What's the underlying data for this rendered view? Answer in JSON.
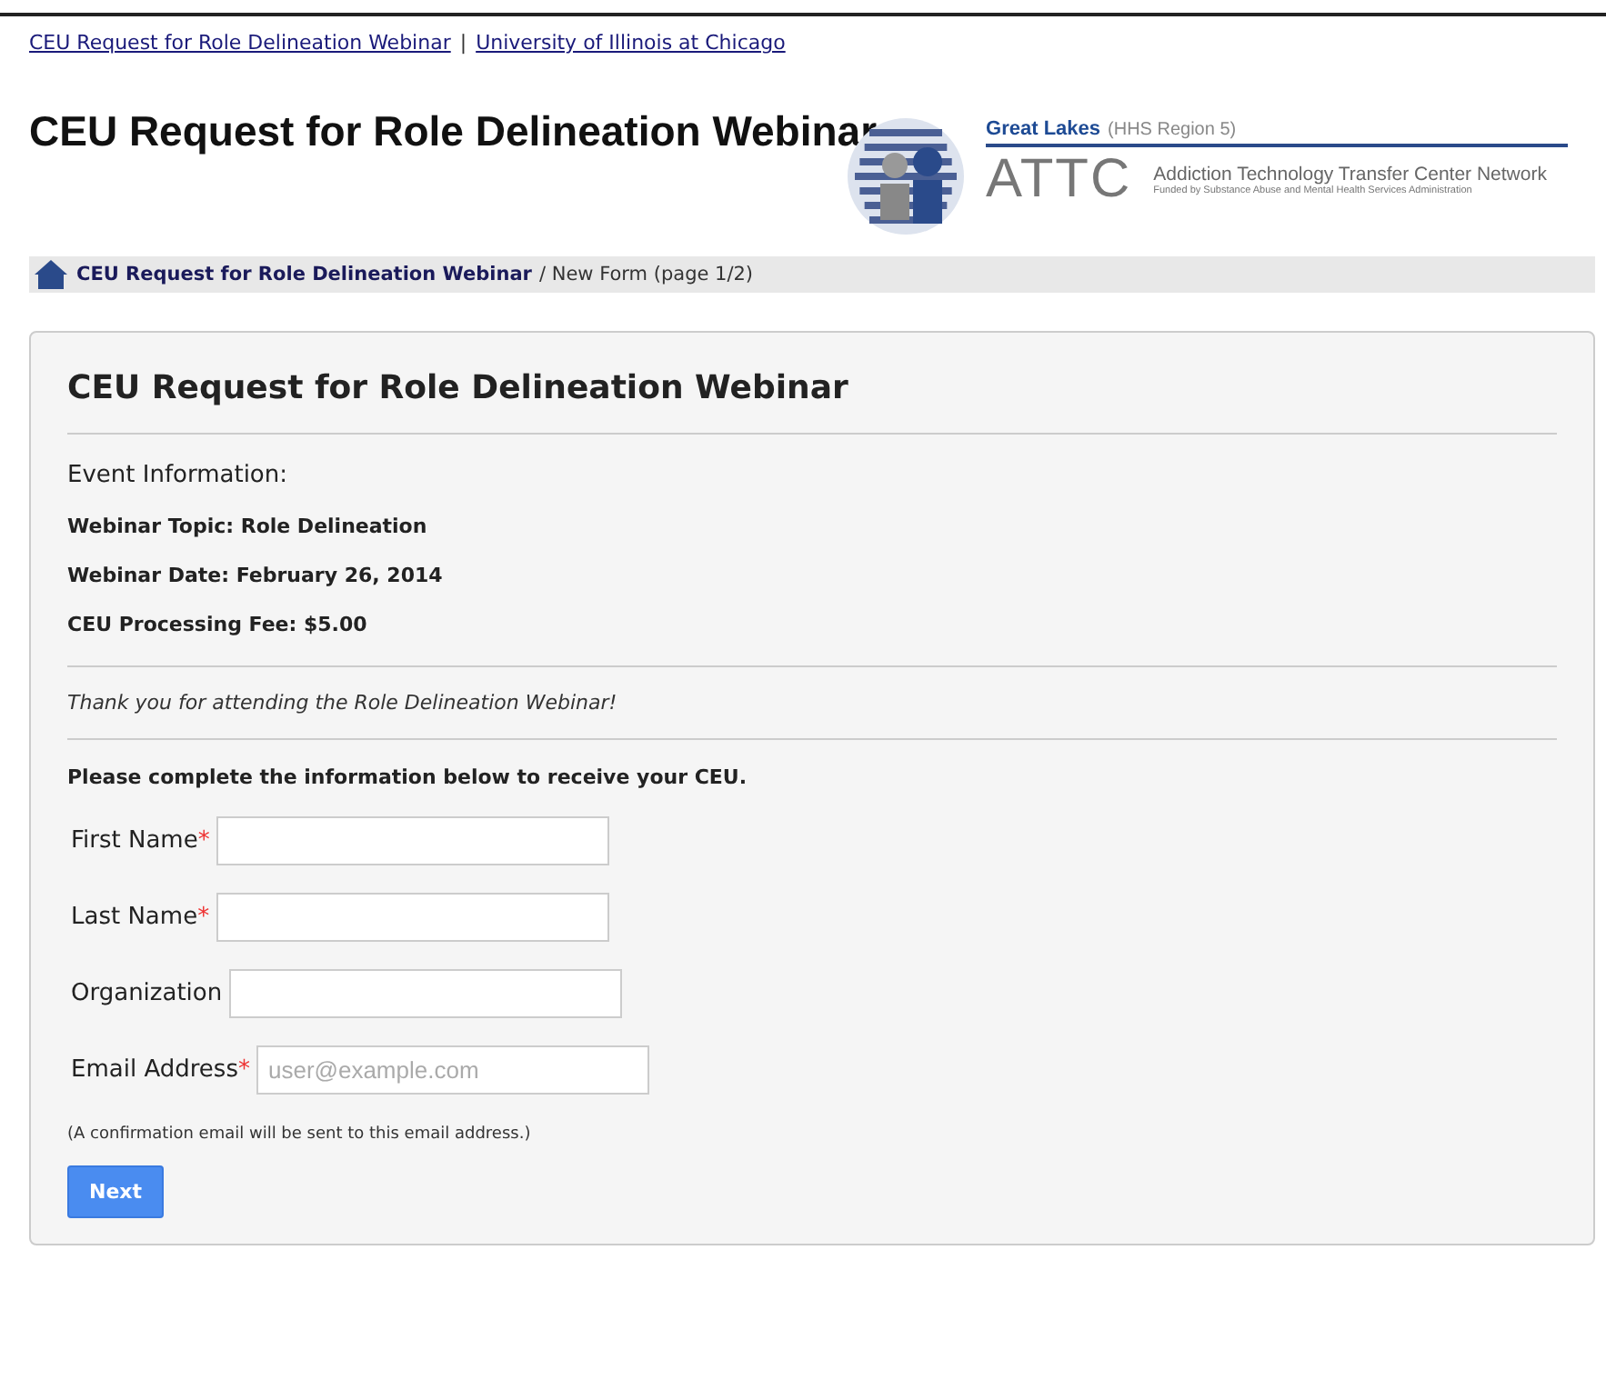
{
  "top_links": [
    {
      "label": "CEU Request for Role Delineation Webinar"
    },
    {
      "label": "University of Illinois at Chicago"
    }
  ],
  "separator": "|",
  "page_title": "CEU Request for Role Delineation Webinar",
  "logo": {
    "region": "Great Lakes",
    "region_note": "(HHS Region 5)",
    "acronym": "ATTC",
    "network": "Addiction Technology Transfer Center Network",
    "funded": "Funded by Substance Abuse and Mental Health Services Administration"
  },
  "breadcrumb": {
    "link": "CEU Request for Role Delineation Webinar",
    "current": "/ New Form (page 1/2)"
  },
  "form": {
    "title": "CEU Request for Role Delineation Webinar",
    "section": "Event Information:",
    "info": [
      "Webinar Topic: Role Delineation",
      "Webinar Date: February 26, 2014",
      "CEU Processing Fee: $5.00"
    ],
    "thanks": "Thank you for attending the Role Delineation Webinar!",
    "instructions": "Please complete the information below to receive your CEU.",
    "fields": [
      {
        "label": "First Name",
        "required": true
      },
      {
        "label": "Last Name",
        "required": true
      },
      {
        "label": "Organization",
        "required": false
      },
      {
        "label": "Email Address",
        "required": true,
        "placeholder": "user@example.com"
      }
    ],
    "required_mark": "*",
    "note": "(A confirmation email will be sent to this email address.)",
    "button": "Next"
  }
}
